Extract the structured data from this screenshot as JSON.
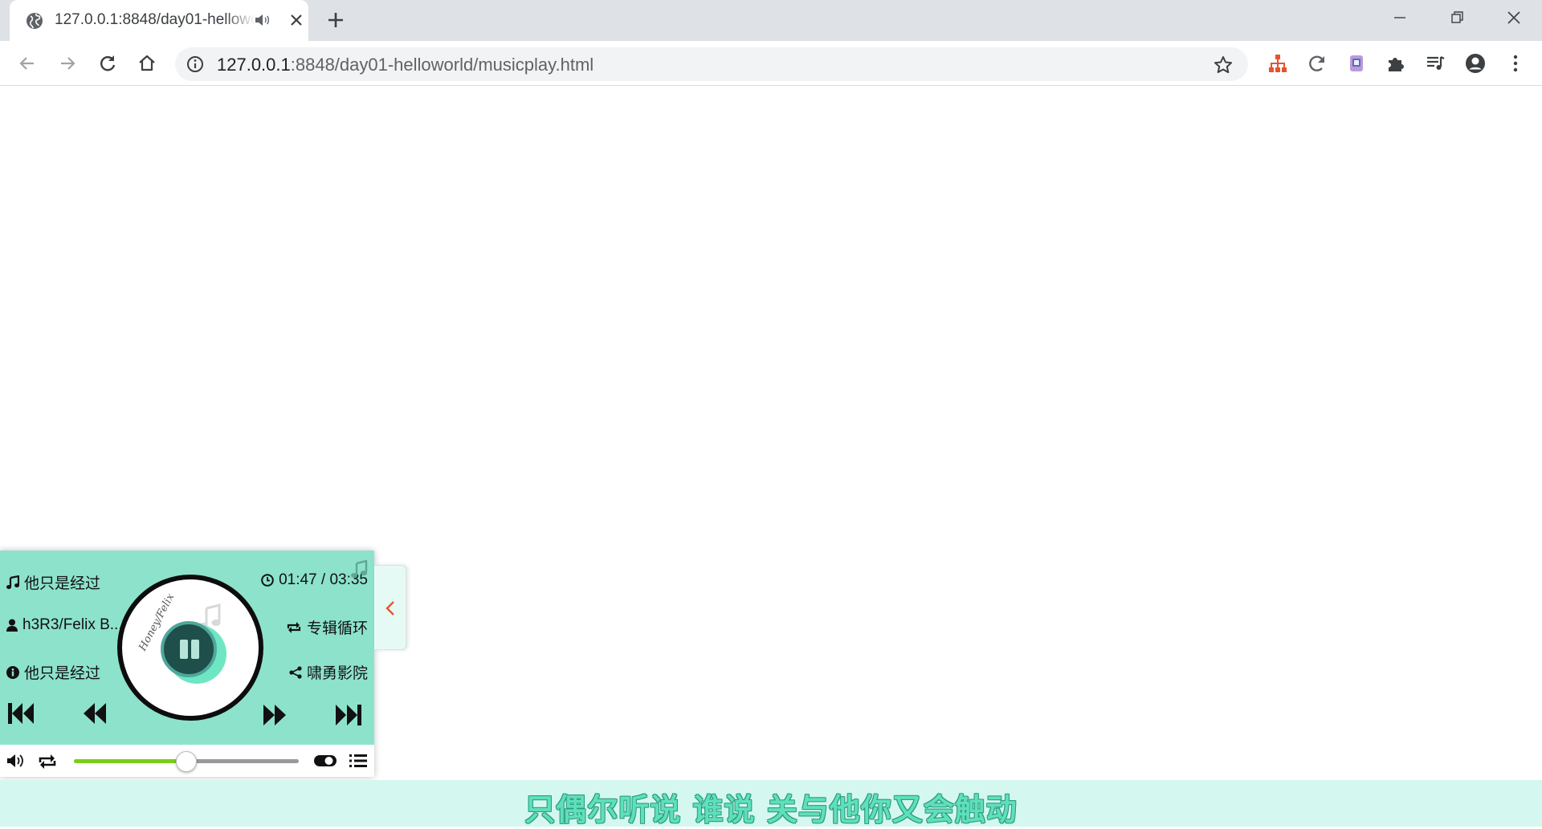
{
  "browser": {
    "tab": {
      "title": "127.0.0.1:8848/day01-helloworld/musicplay.html"
    },
    "address": {
      "host": "127.0.0.1",
      "rest": ":8848/day01-helloworld/musicplay.html"
    }
  },
  "player": {
    "song_title": "他只是经过",
    "artist": "h3R3/Felix B...",
    "album": "他只是经过",
    "time": "01:47 / 03:35",
    "mode": "专辑循环",
    "source": "啸勇影院",
    "disc_signature": "Honey/Felix",
    "progress_percent": 50,
    "accent_color": "#8de2cc",
    "progress_color": "#7ccd18"
  },
  "lyric": {
    "text": "只偶尔听说 谁说 关与他你又会触动"
  }
}
